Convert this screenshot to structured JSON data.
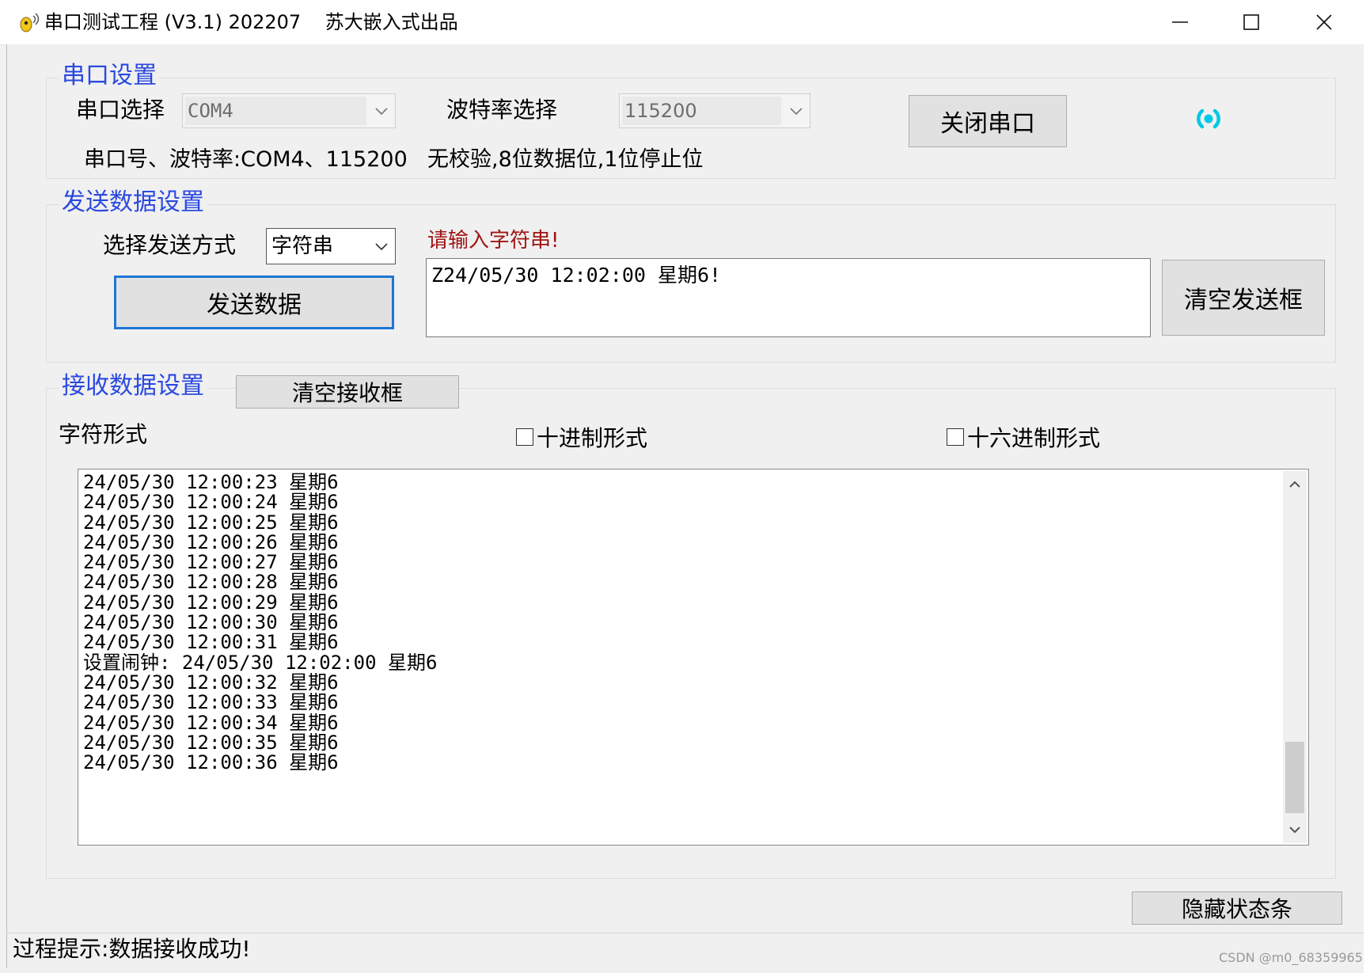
{
  "window": {
    "title": "串口测试工程 (V3.1) 202207    苏大嵌入式出品",
    "controls": [
      "minimize",
      "maximize",
      "close"
    ]
  },
  "serial_settings": {
    "group_title": "串口设置",
    "port_label": "串口选择",
    "port_value": "COM4",
    "baud_label": "波特率选择",
    "baud_value": "115200",
    "toggle_button": "关闭串口",
    "status_icon": "radio-signal-icon",
    "info_line": "串口号、波特率:COM4、115200",
    "format_line": "无校验,8位数据位,1位停止位",
    "accent_color": "#00c8e8"
  },
  "send_settings": {
    "group_title": "发送数据设置",
    "mode_label": "选择发送方式",
    "mode_value": "字符串",
    "prompt": "请输入字符串!",
    "prompt_color": "#a01414",
    "input_value": "Z24/05/30 12:02:00 星期6!",
    "send_button": "发送数据",
    "clear_button": "清空发送框"
  },
  "receive_settings": {
    "group_title": "接收数据设置",
    "clear_button": "清空接收框",
    "char_mode_label": "字符形式",
    "decimal_label": "十进制形式",
    "decimal_checked": false,
    "hex_label": "十六进制形式",
    "hex_checked": false,
    "lines": [
      "24/05/30 12:00:23 星期6",
      "24/05/30 12:00:24 星期6",
      "24/05/30 12:00:25 星期6",
      "24/05/30 12:00:26 星期6",
      "24/05/30 12:00:27 星期6",
      "24/05/30 12:00:28 星期6",
      "24/05/30 12:00:29 星期6",
      "24/05/30 12:00:30 星期6",
      "24/05/30 12:00:31 星期6",
      "设置闹钟: 24/05/30 12:02:00 星期6",
      "24/05/30 12:00:32 星期6",
      "24/05/30 12:00:33 星期6",
      "24/05/30 12:00:34 星期6",
      "24/05/30 12:00:35 星期6",
      "24/05/30 12:00:36 星期6"
    ]
  },
  "footer": {
    "hide_status_button": "隐藏状态条",
    "status_text": "过程提示:数据接收成功!",
    "watermark": "CSDN @m0_68359965"
  }
}
